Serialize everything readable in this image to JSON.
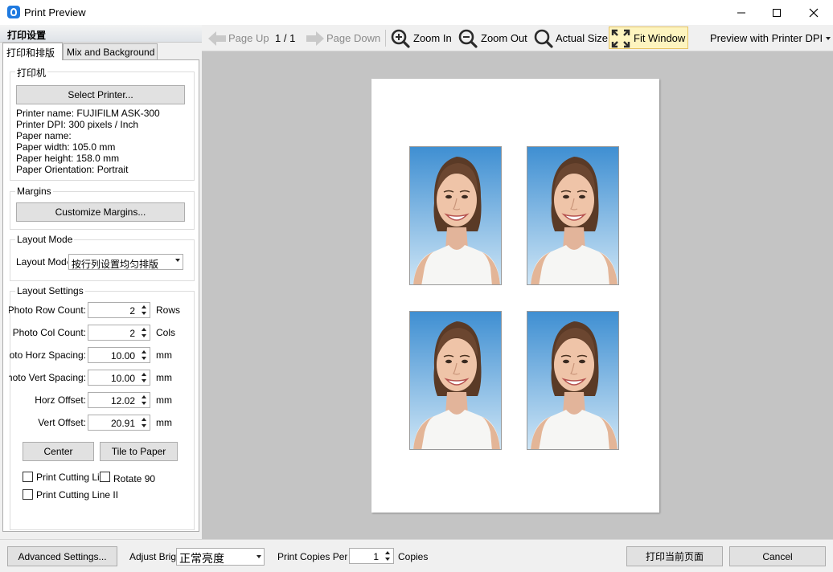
{
  "window": {
    "title": "Print Preview",
    "minimize_icon": "minimize-icon",
    "maximize_icon": "maximize-icon",
    "close_icon": "close-icon"
  },
  "left_panel": {
    "header": "打印设置",
    "tabs": [
      {
        "label": "打印和排版",
        "active": true
      },
      {
        "label": "Mix and Background",
        "active": false
      }
    ],
    "printer_group": {
      "title": "打印机",
      "select_button": "Select Printer...",
      "info": [
        "Printer name: FUJIFILM ASK-300",
        "Printer DPI: 300 pixels / Inch",
        "Paper name:",
        "Paper width: 105.0 mm",
        "Paper height: 158.0 mm",
        "Paper Orientation: Portrait"
      ]
    },
    "margins_group": {
      "title": "Margins",
      "button": "Customize Margins..."
    },
    "layout_mode_group": {
      "title": "Layout Mode",
      "label": "Layout Mode",
      "selected": "按行列设置均匀排版"
    },
    "layout_settings_group": {
      "title": "Layout Settings",
      "rows": [
        {
          "label": "Photo Row Count:",
          "value": "2",
          "unit": "Rows"
        },
        {
          "label": "Photo Col Count:",
          "value": "2",
          "unit": "Cols"
        },
        {
          "label": "Photo Horz Spacing:",
          "value": "10.00",
          "unit": "mm"
        },
        {
          "label": "Photo Vert Spacing:",
          "value": "10.00",
          "unit": "mm"
        },
        {
          "label": "Horz Offset:",
          "value": "12.02",
          "unit": "mm"
        },
        {
          "label": "Vert Offset:",
          "value": "20.91",
          "unit": "mm"
        }
      ],
      "center_button": "Center",
      "tile_button": "Tile to Paper",
      "checkboxes": [
        {
          "label": "Print Cutting Line",
          "checked": false
        },
        {
          "label": "Rotate 90",
          "checked": false
        },
        {
          "label": "Print Cutting Line II",
          "checked": false
        }
      ]
    }
  },
  "toolbar": {
    "page_up": "Page Up",
    "page_indicator": "1 / 1",
    "page_down": "Page Down",
    "zoom_in": "Zoom In",
    "zoom_out": "Zoom Out",
    "actual_size": "Actual Size",
    "fit_window": "Fit Window",
    "preview_mode": "Preview with Printer DPI"
  },
  "preview": {
    "photo_count": 4,
    "colors": {
      "page_bg": "#c4c4c4",
      "paper": "#ffffff",
      "photo_bg_top": "#3f8fd2",
      "photo_bg_bottom": "#cfe6f6"
    }
  },
  "bottom_bar": {
    "advanced_button": "Advanced Settings...",
    "brightness_label": "Adjust Brightness",
    "brightness_value": "正常亮度",
    "copies_label": "Print Copies Per",
    "copies_value": "1",
    "copies_unit": "Copies",
    "print_button": "打印当前页面",
    "cancel_button": "Cancel"
  }
}
